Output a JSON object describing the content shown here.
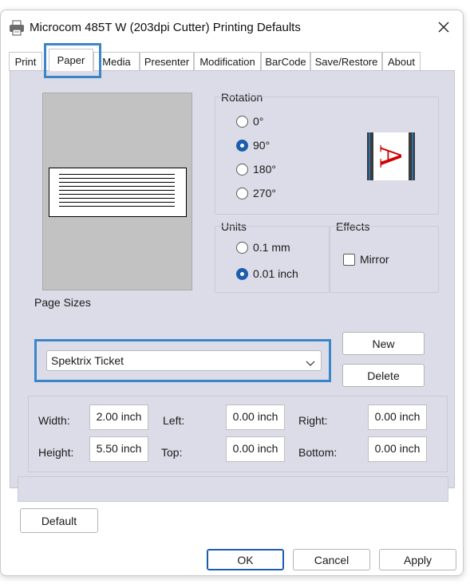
{
  "window": {
    "title": "Microcom 485T W (203dpi Cutter) Printing Defaults",
    "icon": "printer-icon",
    "close_icon": "close-icon"
  },
  "tabs": [
    {
      "label": "Print"
    },
    {
      "label": "Paper",
      "active": true
    },
    {
      "label": "Media"
    },
    {
      "label": "Presenter"
    },
    {
      "label": "Modification"
    },
    {
      "label": "BarCode"
    },
    {
      "label": "Save/Restore"
    },
    {
      "label": "About"
    }
  ],
  "rotation": {
    "label": "Rotation",
    "options": [
      "0°",
      "90°",
      "180°",
      "270°"
    ],
    "selected": "90°",
    "preview_letter": "A"
  },
  "units": {
    "label": "Units",
    "options": [
      "0.1 mm",
      "0.01 inch"
    ],
    "selected": "0.01 inch"
  },
  "effects": {
    "label": "Effects",
    "mirror_label": "Mirror",
    "mirror_checked": false
  },
  "page_sizes": {
    "label": "Page Sizes",
    "selected": "Spektrix Ticket",
    "new_label": "New",
    "delete_label": "Delete"
  },
  "dimensions": {
    "width_label": "Width:",
    "width_value": "2.00 inch",
    "height_label": "Height:",
    "height_value": "5.50 inch",
    "left_label": "Left:",
    "left_value": "0.00 inch",
    "top_label": "Top:",
    "top_value": "0.00 inch",
    "right_label": "Right:",
    "right_value": "0.00 inch",
    "bottom_label": "Bottom:",
    "bottom_value": "0.00 inch"
  },
  "buttons": {
    "default_label": "Default",
    "ok_label": "OK",
    "cancel_label": "Cancel",
    "apply_label": "Apply"
  },
  "colors": {
    "accent": "#1c5dac",
    "highlight": "#3a86c8",
    "panel": "#dcdce8"
  }
}
